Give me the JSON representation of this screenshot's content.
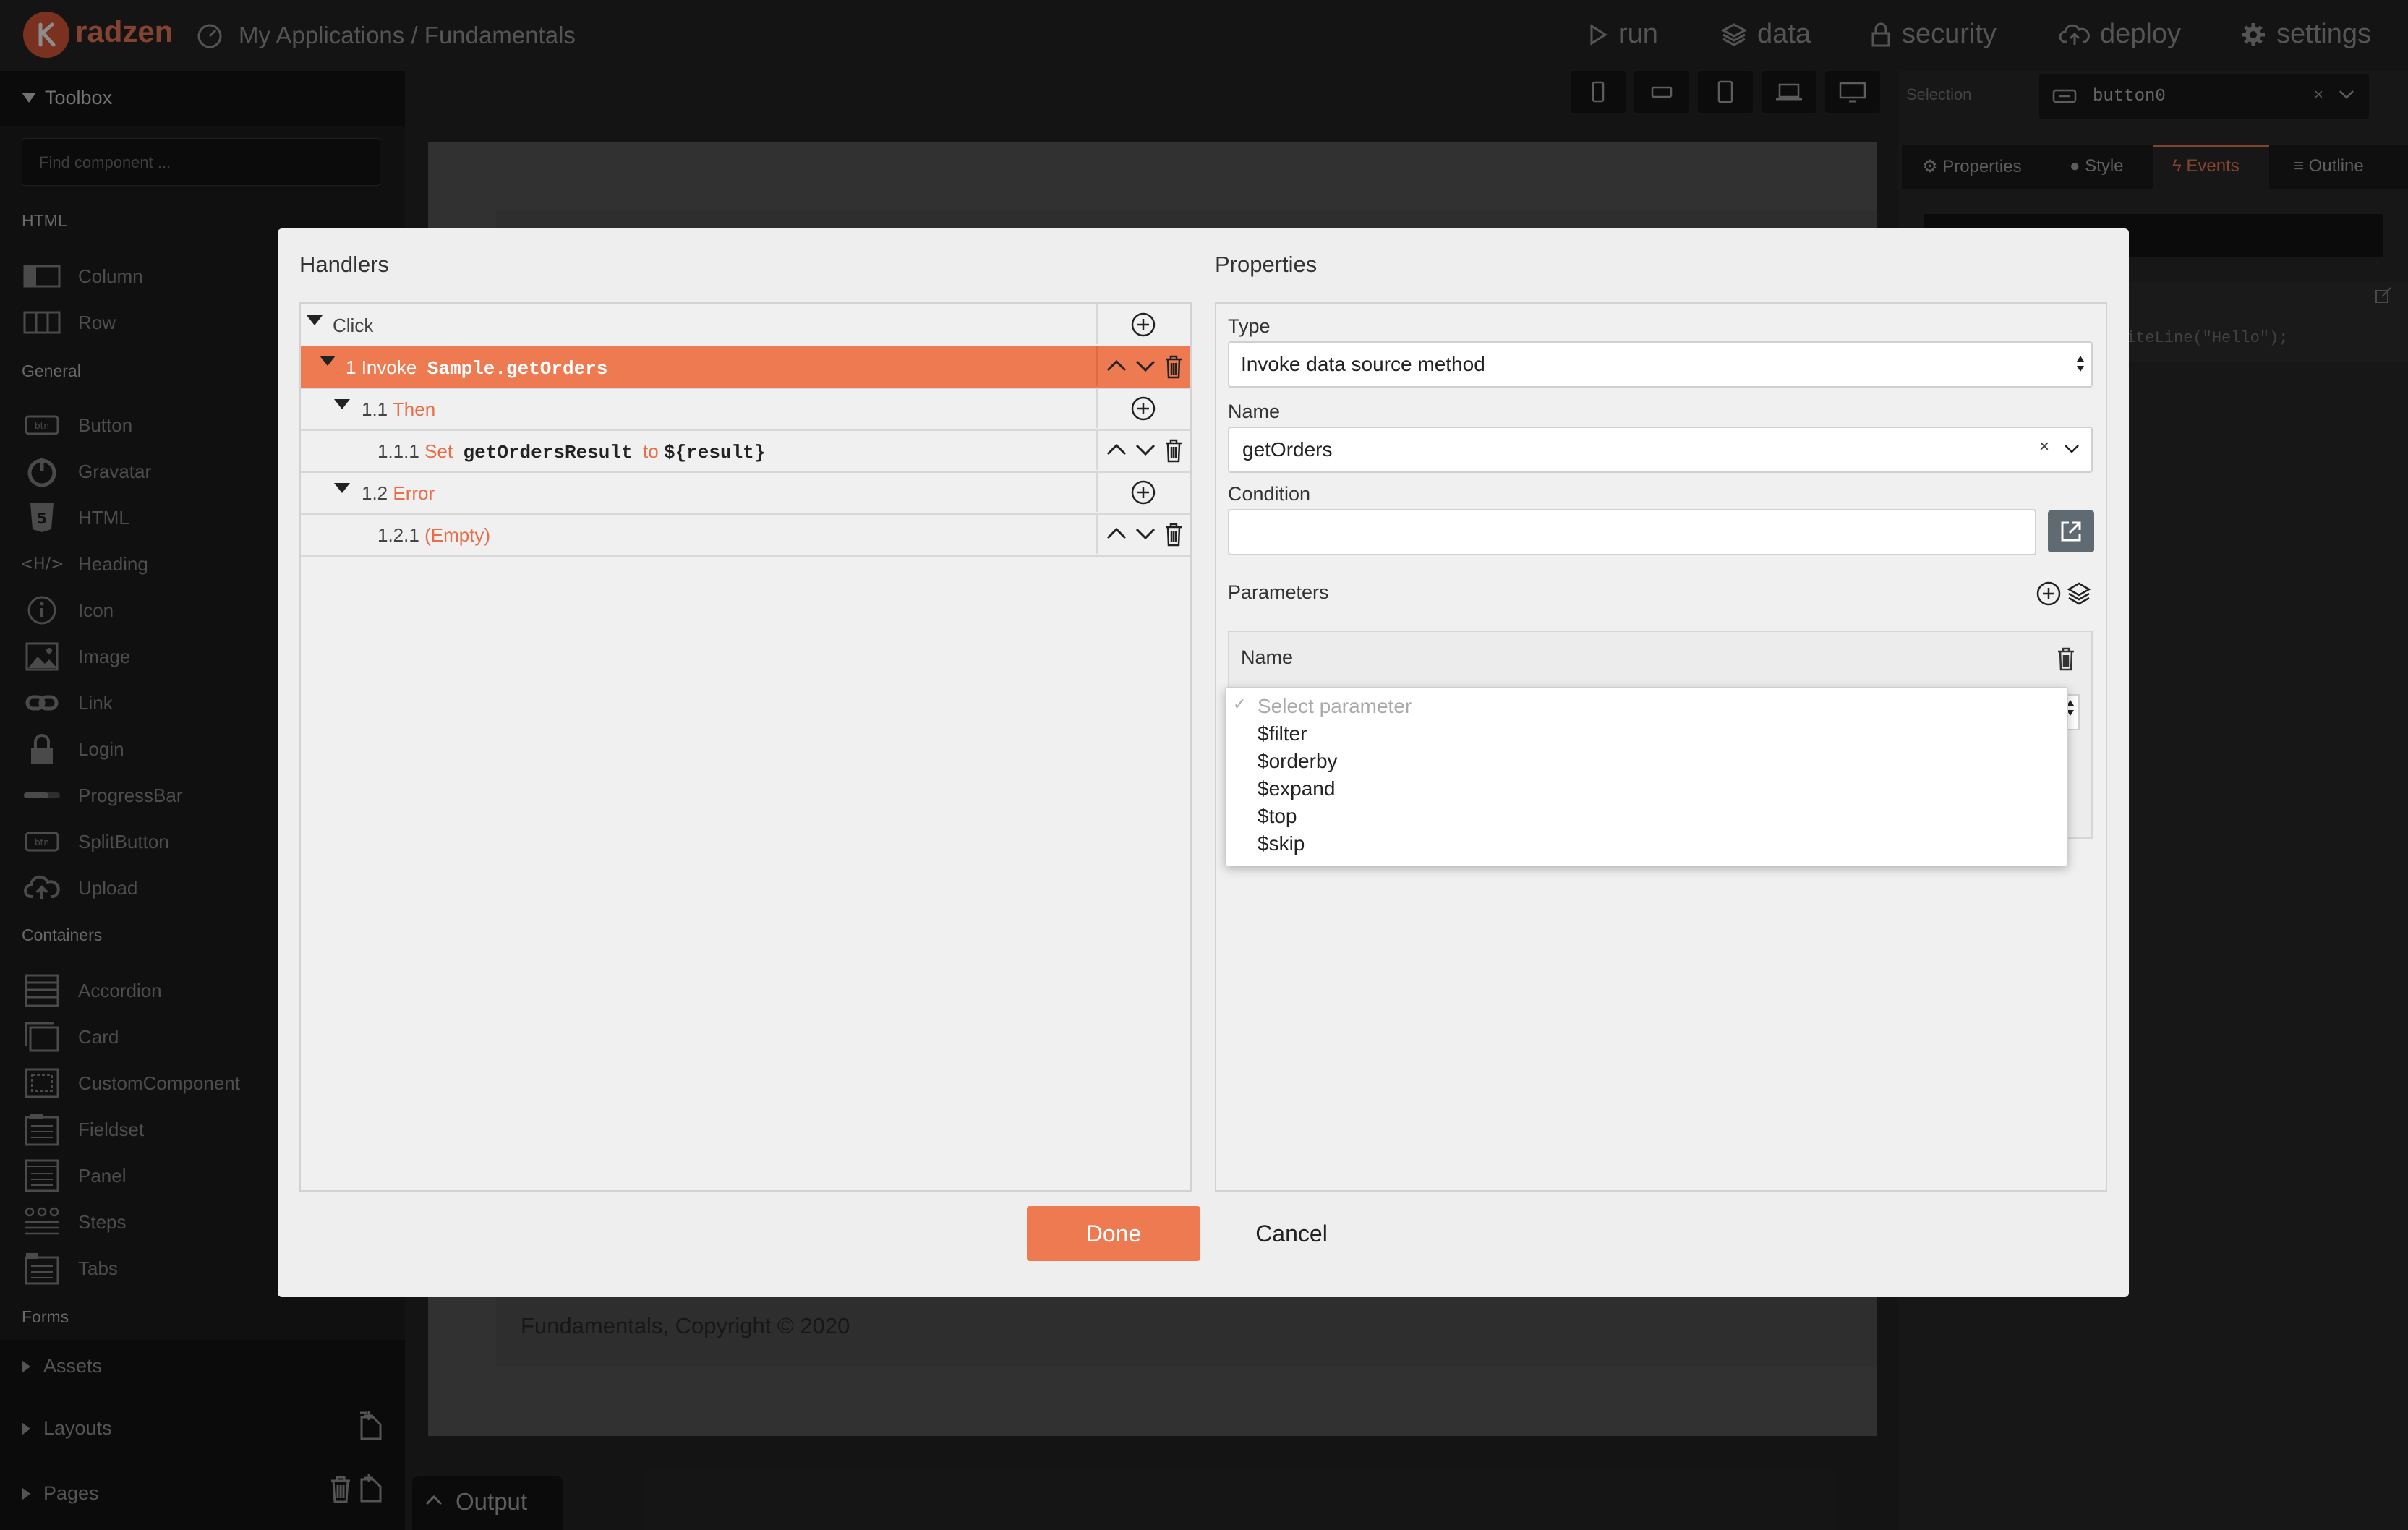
{
  "app": {
    "logo_text": "radzen",
    "breadcrumb": "My Applications / Fundamentals",
    "nav": [
      "run",
      "data",
      "security",
      "deploy",
      "settings"
    ]
  },
  "toolbox": {
    "title": "Toolbox",
    "search_placeholder": "Find component ...",
    "sections": [
      {
        "title": "HTML",
        "items": [
          "Column",
          "Row"
        ]
      },
      {
        "title": "General",
        "items": [
          "Button",
          "Gravatar",
          "HTML",
          "Heading",
          "Icon",
          "Image",
          "Link",
          "Login",
          "ProgressBar",
          "SplitButton",
          "Upload"
        ]
      },
      {
        "title": "Containers",
        "items": [
          "Accordion",
          "Card",
          "CustomComponent",
          "Fieldset",
          "Panel",
          "Steps",
          "Tabs"
        ]
      },
      {
        "title": "Forms",
        "items": []
      }
    ],
    "collapsed": [
      "Assets",
      "Layouts",
      "Pages"
    ]
  },
  "canvas": {
    "footer_text": "Fundamentals, Copyright © 2020",
    "output_label": "Output"
  },
  "right_panel": {
    "selection_label": "Selection",
    "selection_value": "button0",
    "tabs": [
      "Properties",
      "Style",
      "Events",
      "Outline"
    ],
    "code_snippet": "iteLine(\"Hello\");"
  },
  "modal": {
    "handlers_title": "Handlers",
    "properties_title": "Properties",
    "rows": [
      {
        "num": "",
        "keyword": "Click",
        "rest": ""
      },
      {
        "num": "1",
        "keyword": "Invoke",
        "rest": "Sample.getOrders"
      },
      {
        "num": "1.1",
        "keyword": "Then",
        "rest": ""
      },
      {
        "num": "1.1.1",
        "keyword": "Set",
        "rest": "getOrdersResult",
        "keyword2": "to",
        "rest2": "${result}"
      },
      {
        "num": "1.2",
        "keyword": "Error",
        "rest": ""
      },
      {
        "num": "1.2.1",
        "keyword": "(Empty)",
        "rest": ""
      }
    ],
    "props": {
      "type_label": "Type",
      "type_value": "Invoke data source method",
      "name_label": "Name",
      "name_value": "getOrders",
      "condition_label": "Condition",
      "condition_value": "",
      "parameters_label": "Parameters",
      "param_col_name": "Name"
    },
    "dropdown": {
      "placeholder": "Select parameter",
      "options": [
        "$filter",
        "$orderby",
        "$expand",
        "$top",
        "$skip"
      ]
    },
    "done_label": "Done",
    "cancel_label": "Cancel"
  },
  "colors": {
    "accent": "#ee7a52",
    "logo": "#e05a3a"
  }
}
